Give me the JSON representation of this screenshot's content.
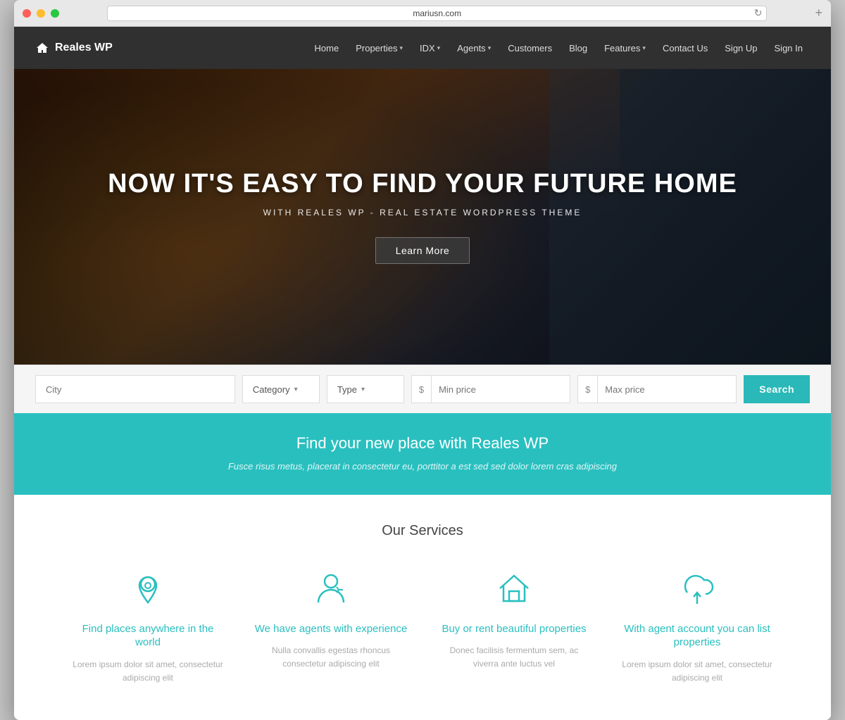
{
  "browser": {
    "url": "mariusn.com",
    "refresh_icon": "↻",
    "add_tab_icon": "+"
  },
  "navbar": {
    "brand_name": "Reales WP",
    "nav_items": [
      {
        "label": "Home",
        "has_arrow": false
      },
      {
        "label": "Properties",
        "has_arrow": true
      },
      {
        "label": "IDX",
        "has_arrow": true
      },
      {
        "label": "Agents",
        "has_arrow": true
      },
      {
        "label": "Customers",
        "has_arrow": false
      },
      {
        "label": "Blog",
        "has_arrow": false
      },
      {
        "label": "Features",
        "has_arrow": true
      },
      {
        "label": "Contact Us",
        "has_arrow": false
      },
      {
        "label": "Sign Up",
        "has_arrow": false
      },
      {
        "label": "Sign In",
        "has_arrow": false
      }
    ]
  },
  "hero": {
    "title": "NOW IT'S EASY TO FIND YOUR FUTURE HOME",
    "subtitle": "WITH REALES WP - REAL ESTATE WORDPRESS THEME",
    "cta_label": "Learn More"
  },
  "search": {
    "city_placeholder": "City",
    "category_label": "Category",
    "type_label": "Type",
    "min_price_placeholder": "Min price",
    "max_price_placeholder": "Max price",
    "currency_symbol": "$",
    "search_button_label": "Search"
  },
  "teal_band": {
    "title": "Find your new place with Reales WP",
    "description": "Fusce risus metus, placerat in consectetur eu, porttitor a est sed sed dolor lorem cras adipiscing"
  },
  "services": {
    "section_title": "Our Services",
    "items": [
      {
        "icon": "location",
        "title": "Find places anywhere in the world",
        "description": "Lorem ipsum dolor sit amet, consectetur adipiscing elit"
      },
      {
        "icon": "agent",
        "title": "We have agents with experience",
        "description": "Nulla convallis egestas rhoncus consectetur adipiscing elit"
      },
      {
        "icon": "home",
        "title": "Buy or rent beautiful properties",
        "description": "Donec facilisis fermentum sem, ac viverra ante luctus vel"
      },
      {
        "icon": "cloud",
        "title": "With agent account you can list properties",
        "description": "Lorem ipsum dolor sit amet, consectetur adipiscing elit"
      }
    ]
  }
}
